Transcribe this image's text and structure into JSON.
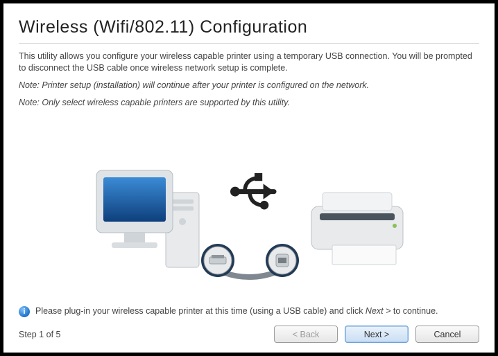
{
  "title": "Wireless (Wifi/802.11) Configuration",
  "intro": "This utility allows you configure your wireless capable printer using a temporary USB connection. You will be prompted to disconnect the USB cable once wireless network setup is complete.",
  "note1": "Note: Printer setup (installation) will continue after your printer is configured on the network.",
  "note2": "Note: Only select wireless capable printers are supported by this utility.",
  "info_prefix": "Please plug-in your wireless capable printer at this time (using a USB cable) and click ",
  "info_next_ref": "Next >",
  "info_suffix": " to continue.",
  "step_label": "Step 1 of 5",
  "buttons": {
    "back": "< Back",
    "next": "Next >",
    "cancel": "Cancel"
  },
  "info_icon_glyph": "i"
}
